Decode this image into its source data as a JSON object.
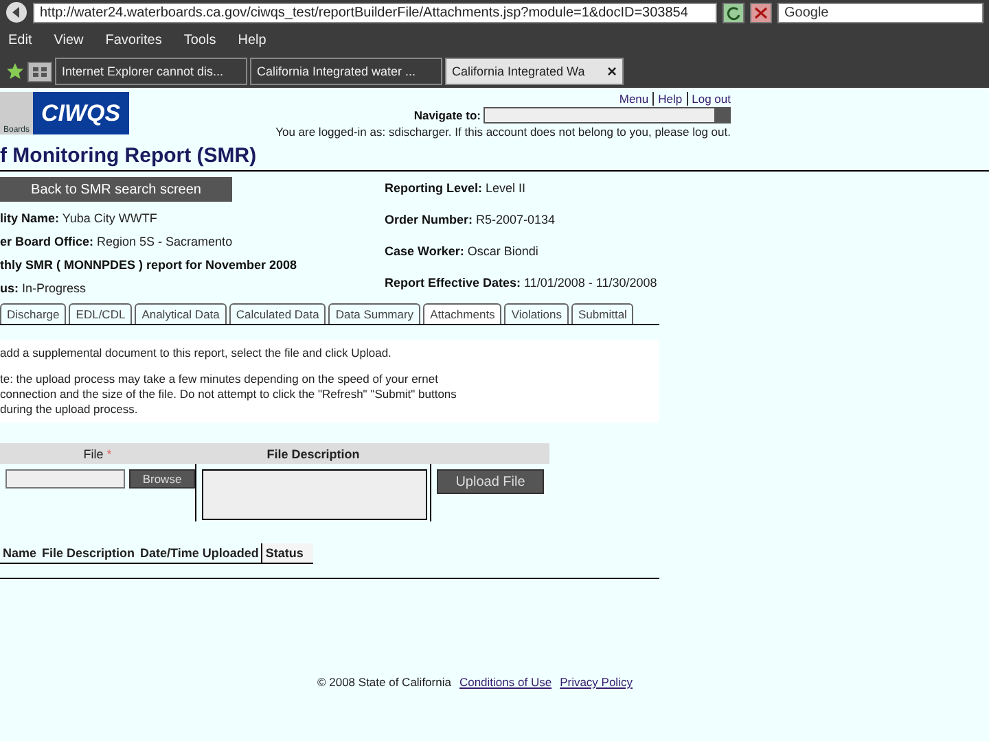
{
  "browser": {
    "address": "http://water24.waterboards.ca.gov/ciwqs_test/reportBuilderFile/Attachments.jsp?module=1&docID=303854",
    "search_placeholder": "Google",
    "menu": [
      "Edit",
      "View",
      "Favorites",
      "Tools",
      "Help"
    ],
    "tabs": [
      {
        "label": "Internet Explorer cannot dis...",
        "selected": false
      },
      {
        "label": "California Integrated water ...",
        "selected": false
      },
      {
        "label": "California Integrated Wa",
        "selected": true
      }
    ],
    "tab_close": "×"
  },
  "header": {
    "logo_text": "CIWQS",
    "logo_sub": "Boards",
    "links": [
      "Menu",
      "Help",
      "Log out"
    ],
    "navigate_label": "Navigate to:",
    "login_message": "You are logged-in as: sdischarger. If this account does not belong to you, please log out."
  },
  "title": "f Monitoring Report (SMR)",
  "back_button": "Back to SMR search screen",
  "info_left": [
    {
      "label": "lity Name:",
      "value": "Yuba City WWTF"
    },
    {
      "label": "er Board Office:",
      "value": "Region 5S - Sacramento"
    },
    {
      "label": "thly SMR ( MONNPDES ) report for November 2008"
    },
    {
      "label": "us:",
      "value": "In-Progress"
    }
  ],
  "info_right": [
    {
      "label": "Reporting Level:",
      "value": "Level II"
    },
    {
      "label": "Order Number:",
      "value": "R5-2007-0134"
    },
    {
      "label": "Case Worker:",
      "value": "Oscar Biondi"
    },
    {
      "label": "Report Effective Dates:",
      "value": "11/01/2008 - 11/30/2008"
    }
  ],
  "tabs": [
    {
      "label": "Discharge",
      "selected": false
    },
    {
      "label": "EDL/CDL",
      "selected": false
    },
    {
      "label": "Analytical Data",
      "selected": false
    },
    {
      "label": "Calculated Data",
      "selected": false
    },
    {
      "label": "Data Summary",
      "selected": false
    },
    {
      "label": "Attachments",
      "selected": true
    },
    {
      "label": "Violations",
      "selected": false
    },
    {
      "label": "Submittal",
      "selected": false
    }
  ],
  "instructions": [
    "add a supplemental document to this report, select the file and click Upload.",
    "te: the upload process may take a few minutes depending on the speed of your ernet connection and the size of the file. Do not attempt to click the \"Refresh\" \"Submit\" buttons during the upload process."
  ],
  "upload": {
    "file_header": "File",
    "required_mark": "*",
    "description_header": "File Description",
    "browse_button": "Browse",
    "upload_button": "Upload File"
  },
  "attachments_table": {
    "columns": [
      "Name",
      "File Description",
      "Date/Time Uploaded",
      "Status"
    ]
  },
  "footer": {
    "copyright": "© 2008 State of California",
    "links": [
      "Conditions of Use",
      "Privacy Policy"
    ]
  }
}
